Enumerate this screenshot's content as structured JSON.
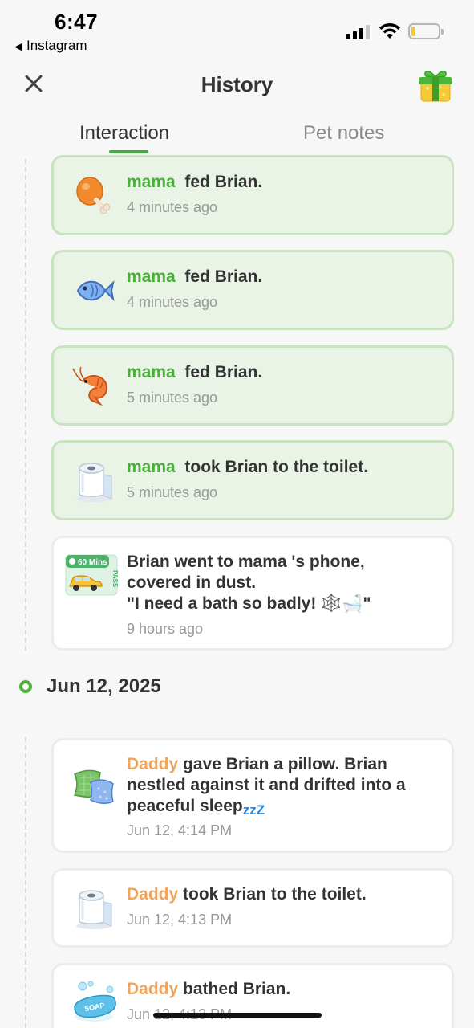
{
  "status_bar": {
    "time": "6:47",
    "back_app": "Instagram"
  },
  "header": {
    "title": "History",
    "close_icon": "close-icon",
    "gift_icon": "gift-icon"
  },
  "tabs": [
    {
      "label": "Interaction",
      "active": true
    },
    {
      "label": "Pet notes",
      "active": false
    }
  ],
  "entries_today": [
    {
      "actor": "mama",
      "action": "fed Brian.",
      "time": "4 minutes ago",
      "icon": "chicken-leg-icon"
    },
    {
      "actor": "mama",
      "action": "fed Brian.",
      "time": "4 minutes ago",
      "icon": "fish-icon"
    },
    {
      "actor": "mama",
      "action": "fed Brian.",
      "time": "5 minutes ago",
      "icon": "shrimp-icon"
    },
    {
      "actor": "mama",
      "action": "took Brian to the toilet.",
      "time": "5 minutes ago",
      "icon": "toilet-paper-icon"
    },
    {
      "line1": "Brian went to mama 's phone,",
      "line2": "covered in dust.",
      "line3": "\"I need a bath so badly! 🕸️🛁\"",
      "time": "9 hours ago",
      "icon": "car-pass-icon",
      "pass_label": "60 Mins",
      "pass_side": "PASS"
    }
  ],
  "date_section": {
    "date": "Jun 12, 2025"
  },
  "entries_jun12": [
    {
      "actor": "Daddy",
      "line1": "gave Brian a pillow. Brian",
      "line2": "nestled against it and drifted into a",
      "line3": "peaceful sleep",
      "zzz": "zzZ",
      "time": "Jun 12, 4:14 PM",
      "icon": "pillow-icon"
    },
    {
      "actor": "Daddy",
      "action": "took Brian to the toilet.",
      "time": "Jun 12, 4:13 PM",
      "icon": "toilet-paper-icon"
    },
    {
      "actor": "Daddy",
      "action": "bathed Brian.",
      "time": "Jun 12, 4:13 PM",
      "icon": "soap-icon",
      "soap_label": "SOAP"
    }
  ]
}
